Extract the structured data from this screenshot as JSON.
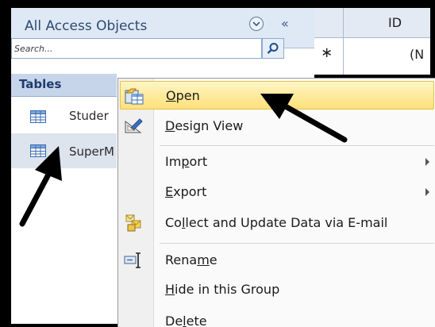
{
  "nav": {
    "title": "All Access Objects",
    "search_placeholder": "Search...",
    "group": "Tables",
    "tables": [
      {
        "label": "Studer"
      },
      {
        "label": "SuperM"
      }
    ]
  },
  "datasheet": {
    "column_header": "ID",
    "new_row_marker": "∗",
    "new_row_value": "(N"
  },
  "context_menu": {
    "items": [
      {
        "pre": "",
        "key": "O",
        "post": "pen",
        "icon": "open-icon"
      },
      {
        "pre": "",
        "key": "D",
        "post": "esign View",
        "icon": "design-view-icon"
      },
      {
        "pre": "Im",
        "key": "p",
        "post": "ort",
        "submenu": true
      },
      {
        "pre": "",
        "key": "E",
        "post": "xport",
        "submenu": true
      },
      {
        "pre": "Co",
        "key": "l",
        "post": "lect and Update Data via E-mail",
        "icon": "collect-data-icon"
      },
      {
        "pre": "Rena",
        "key": "m",
        "post": "e",
        "icon": "rename-icon"
      },
      {
        "pre": "",
        "key": "H",
        "post": "ide in this Group"
      },
      {
        "pre": "De",
        "key": "l",
        "post": "ete"
      }
    ]
  },
  "colors": {
    "highlight": "#ffe07a",
    "nav_header": "#dfe8f5",
    "arrow": "#000000"
  }
}
